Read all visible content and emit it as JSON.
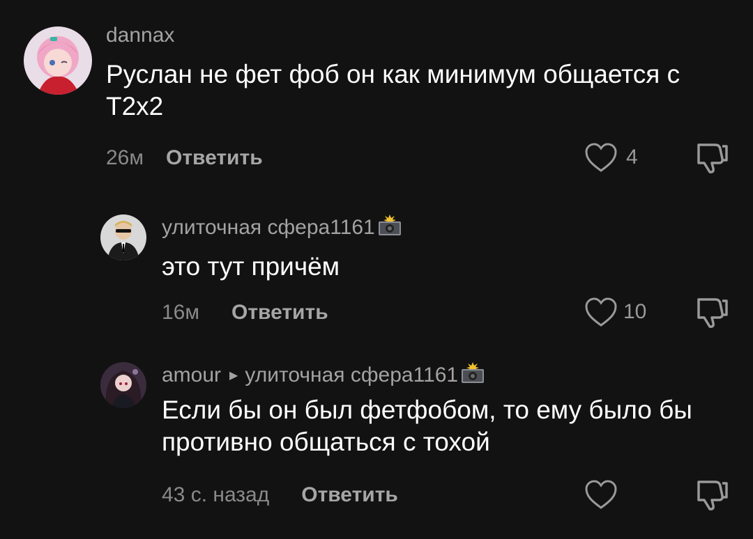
{
  "comments": [
    {
      "username": "dannax",
      "text": "Руслан не фет фоб он как минимум общается с Т2х2",
      "time": "26м",
      "reply_label": "Ответить",
      "likes": "4",
      "avatar_icon": "anime-girl-avatar-pink"
    },
    {
      "username": "улиточная сфера1161",
      "username_emoji": "camera-flash-emoji",
      "text": "это тут причём",
      "time": "16м",
      "reply_label": "Ответить",
      "likes": "10",
      "avatar_icon": "man-in-suit-avatar"
    },
    {
      "username": "amour",
      "reply_to": "улиточная сфера1161",
      "reply_to_emoji": "camera-flash-emoji",
      "text": "Если бы он был фетфобом, то ему было бы противно общаться с тохой",
      "time": "43 с. назад",
      "reply_label": "Ответить",
      "likes": "",
      "avatar_icon": "anime-girl-avatar-dark"
    }
  ],
  "colors": {
    "background": "#121212",
    "username": "#a3a3a3",
    "text": "#ffffff",
    "meta": "#8a8a8a"
  }
}
